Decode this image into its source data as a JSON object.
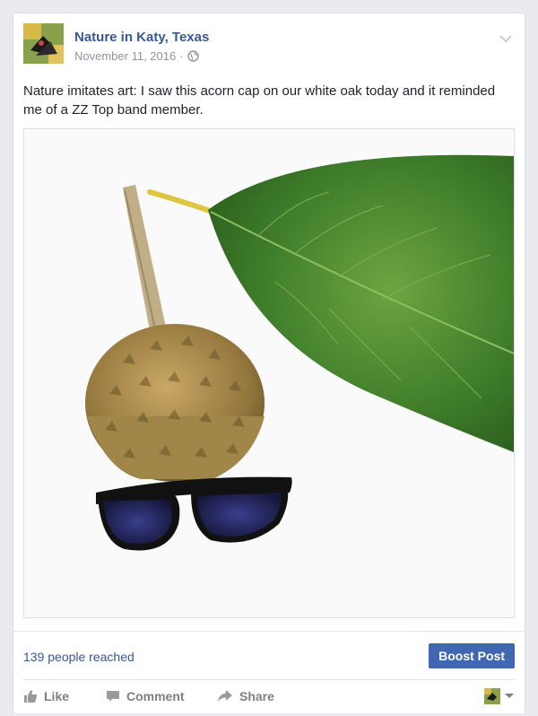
{
  "post": {
    "page_name": "Nature in Katy, Texas",
    "date": "November 11, 2016",
    "meta_separator": "·",
    "text": "Nature imitates art: I saw this acorn cap on our white oak today and it reminded me of a ZZ Top band member.",
    "photo_icon": "acorn-cap-with-oak-leaf-and-sunglasses"
  },
  "insights": {
    "reach": "139 people reached",
    "boost_label": "Boost Post"
  },
  "actions": {
    "like": "Like",
    "comment": "Comment",
    "share": "Share"
  },
  "colors": {
    "link": "#365899",
    "boost": "#4267b2",
    "action_text": "#7f7f7f"
  }
}
